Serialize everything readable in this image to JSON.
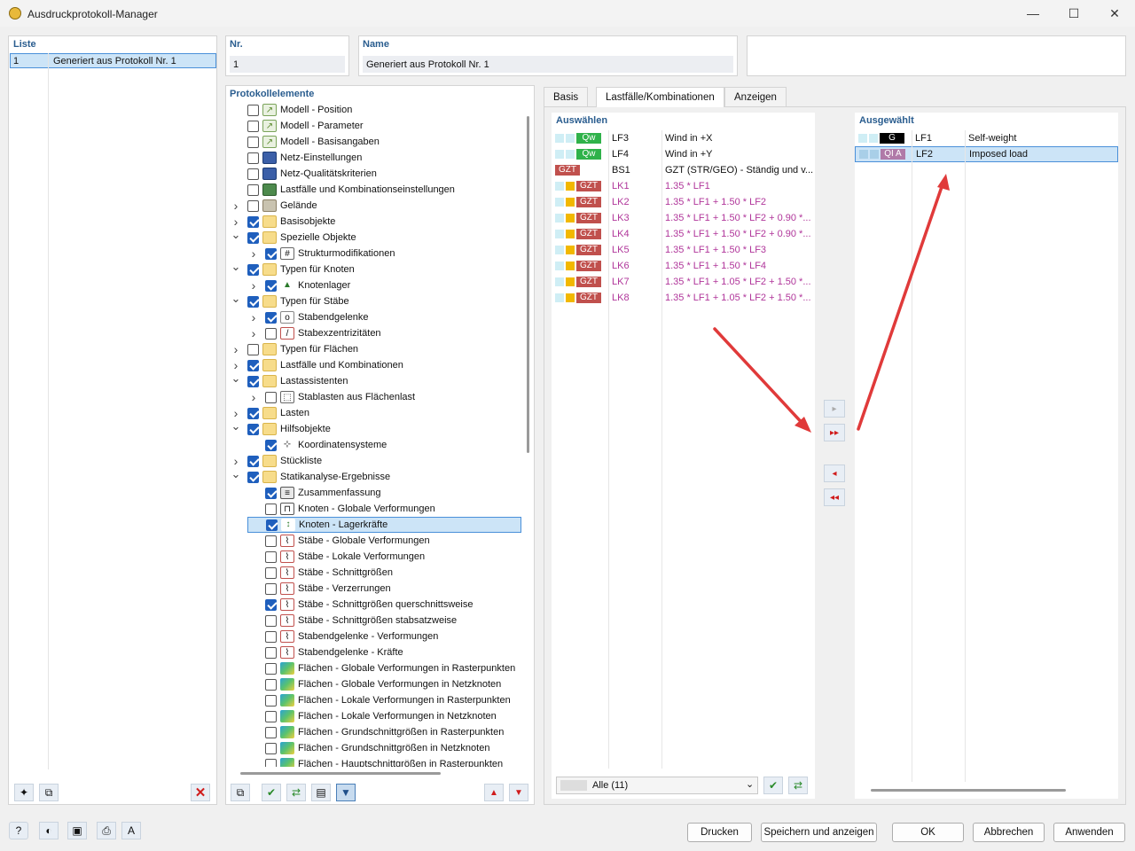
{
  "window": {
    "title": "Ausdruckprotokoll-Manager",
    "min": "—",
    "max": "☐",
    "close": "✕"
  },
  "liste": {
    "header": "Liste",
    "items": [
      {
        "nr": "1",
        "name": "Generiert aus Protokoll Nr. 1"
      }
    ]
  },
  "nr": {
    "label": "Nr.",
    "value": "1"
  },
  "name": {
    "label": "Name",
    "value": "Generiert aus Protokoll Nr. 1"
  },
  "tree": {
    "header": "Protokollelemente",
    "items": [
      {
        "label": "Modell - Position",
        "checked": false,
        "tog": "",
        "level": 0,
        "icon": "model-icon"
      },
      {
        "label": "Modell - Parameter",
        "checked": false,
        "tog": "",
        "level": 0,
        "icon": "model-icon"
      },
      {
        "label": "Modell - Basisangaben",
        "checked": false,
        "tog": "",
        "level": 0,
        "icon": "model-icon"
      },
      {
        "label": "Netz-Einstellungen",
        "checked": false,
        "tog": "",
        "level": 0,
        "icon": "mesh-icon"
      },
      {
        "label": "Netz-Qualitätskriterien",
        "checked": false,
        "tog": "",
        "level": 0,
        "icon": "mesh-icon"
      },
      {
        "label": "Lastfälle und Kombinationseinstellungen",
        "checked": false,
        "tog": "",
        "level": 0,
        "icon": "loadcase-settings-icon"
      },
      {
        "label": "Gelände",
        "checked": false,
        "tog": ">",
        "level": 0,
        "icon": "terrain-icon"
      },
      {
        "label": "Basisobjekte",
        "checked": true,
        "tog": ">",
        "level": 0,
        "icon": "folder-icon"
      },
      {
        "label": "Spezielle Objekte",
        "checked": true,
        "tog": "v",
        "level": 0,
        "icon": "folder-icon"
      },
      {
        "label": "Strukturmodifikationen",
        "checked": true,
        "tog": ">",
        "level": 1,
        "icon": "grid-icon"
      },
      {
        "label": "Typen für Knoten",
        "checked": true,
        "tog": "v",
        "level": 0,
        "icon": "folder-icon"
      },
      {
        "label": "Knotenlager",
        "checked": true,
        "tog": ">",
        "level": 1,
        "icon": "support-icon"
      },
      {
        "label": "Typen für Stäbe",
        "checked": true,
        "tog": "v",
        "level": 0,
        "icon": "folder-icon"
      },
      {
        "label": "Stabendgelenke",
        "checked": true,
        "tog": ">",
        "level": 1,
        "icon": "hinge-icon"
      },
      {
        "label": "Stabexzentrizitäten",
        "checked": false,
        "tog": ">",
        "level": 1,
        "icon": "eccentricity-icon"
      },
      {
        "label": "Typen für Flächen",
        "checked": false,
        "tog": ">",
        "level": 0,
        "icon": "folder-icon"
      },
      {
        "label": "Lastfälle und Kombinationen",
        "checked": true,
        "tog": ">",
        "level": 0,
        "icon": "folder-icon"
      },
      {
        "label": "Lastassistenten",
        "checked": true,
        "tog": "v",
        "level": 0,
        "icon": "folder-icon"
      },
      {
        "label": "Stablasten aus Flächenlast",
        "checked": false,
        "tog": ">",
        "level": 1,
        "icon": "load-wizard-icon"
      },
      {
        "label": "Lasten",
        "checked": true,
        "tog": ">",
        "level": 0,
        "icon": "folder-icon"
      },
      {
        "label": "Hilfsobjekte",
        "checked": true,
        "tog": "v",
        "level": 0,
        "icon": "folder-icon"
      },
      {
        "label": "Koordinatensysteme",
        "checked": true,
        "tog": "",
        "level": 1,
        "icon": "coordinate-icon"
      },
      {
        "label": "Stückliste",
        "checked": true,
        "tog": ">",
        "level": 0,
        "icon": "folder-icon"
      },
      {
        "label": "Statikanalyse-Ergebnisse",
        "checked": true,
        "tog": "v",
        "level": 0,
        "icon": "folder-icon"
      },
      {
        "label": "Zusammenfassung",
        "checked": true,
        "tog": "",
        "level": 1,
        "icon": "summary-icon"
      },
      {
        "label": "Knoten - Globale Verformungen",
        "checked": false,
        "tog": "",
        "level": 1,
        "icon": "node-deform-icon"
      },
      {
        "label": "Knoten - Lagerkräfte",
        "checked": true,
        "tog": "",
        "level": 1,
        "icon": "support-force-icon",
        "selected": true
      },
      {
        "label": "Stäbe - Globale Verformungen",
        "checked": false,
        "tog": "",
        "level": 1,
        "icon": "member-result-icon"
      },
      {
        "label": "Stäbe - Lokale Verformungen",
        "checked": false,
        "tog": "",
        "level": 1,
        "icon": "member-result-icon"
      },
      {
        "label": "Stäbe - Schnittgrößen",
        "checked": false,
        "tog": "",
        "level": 1,
        "icon": "member-result-icon"
      },
      {
        "label": "Stäbe - Verzerrungen",
        "checked": false,
        "tog": "",
        "level": 1,
        "icon": "member-result-icon"
      },
      {
        "label": "Stäbe - Schnittgrößen querschnittsweise",
        "checked": true,
        "tog": "",
        "level": 1,
        "icon": "member-result-icon"
      },
      {
        "label": "Stäbe - Schnittgrößen stabsatzweise",
        "checked": false,
        "tog": "",
        "level": 1,
        "icon": "member-result-icon"
      },
      {
        "label": "Stabendgelenke - Verformungen",
        "checked": false,
        "tog": "",
        "level": 1,
        "icon": "member-result-icon"
      },
      {
        "label": "Stabendgelenke - Kräfte",
        "checked": false,
        "tog": "",
        "level": 1,
        "icon": "member-result-icon"
      },
      {
        "label": "Flächen - Globale Verformungen in Rasterpunkten",
        "checked": false,
        "tog": "",
        "level": 1,
        "icon": "surface-result-icon"
      },
      {
        "label": "Flächen - Globale Verformungen in Netzknoten",
        "checked": false,
        "tog": "",
        "level": 1,
        "icon": "surface-result-icon"
      },
      {
        "label": "Flächen - Lokale Verformungen in Rasterpunkten",
        "checked": false,
        "tog": "",
        "level": 1,
        "icon": "surface-result-icon"
      },
      {
        "label": "Flächen - Lokale Verformungen in Netzknoten",
        "checked": false,
        "tog": "",
        "level": 1,
        "icon": "surface-result-icon"
      },
      {
        "label": "Flächen - Grundschnittgrößen in Rasterpunkten",
        "checked": false,
        "tog": "",
        "level": 1,
        "icon": "surface-result-icon"
      },
      {
        "label": "Flächen - Grundschnittgrößen in Netzknoten",
        "checked": false,
        "tog": "",
        "level": 1,
        "icon": "surface-result-icon"
      },
      {
        "label": "Flächen - Hauptschnittgrößen in Rasterpunkten",
        "checked": false,
        "tog": "",
        "level": 1,
        "icon": "surface-result-icon"
      }
    ]
  },
  "tabs": [
    "Basis",
    "Lastfälle/Kombinationen",
    "Anzeigen"
  ],
  "auswaehlen": {
    "header": "Auswählen",
    "rows": [
      {
        "sq1": "#cfeef5",
        "sq2": "#cfeef5",
        "tag": "Qw",
        "tagColor": "#2fb24a",
        "id": "LF3",
        "desc": "Wind in +X",
        "magenta": false
      },
      {
        "sq1": "#cfeef5",
        "sq2": "#cfeef5",
        "tag": "Qw",
        "tagColor": "#2fb24a",
        "id": "LF4",
        "desc": "Wind in +Y",
        "magenta": false
      },
      {
        "sq1": "",
        "sq2": "",
        "tag": "GZT",
        "tagColor": "#c0504d",
        "id": "BS1",
        "desc": "GZT (STR/GEO) - Ständig und v...",
        "magenta": false
      },
      {
        "sq1": "#cfeef5",
        "sq2": "#f2b800",
        "tag": "GZT",
        "tagColor": "#c0504d",
        "id": "LK1",
        "desc": "1.35 * LF1",
        "magenta": true
      },
      {
        "sq1": "#cfeef5",
        "sq2": "#f2b800",
        "tag": "GZT",
        "tagColor": "#c0504d",
        "id": "LK2",
        "desc": "1.35 * LF1 + 1.50 * LF2",
        "magenta": true
      },
      {
        "sq1": "#cfeef5",
        "sq2": "#f2b800",
        "tag": "GZT",
        "tagColor": "#c0504d",
        "id": "LK3",
        "desc": "1.35 * LF1 + 1.50 * LF2 + 0.90 *...",
        "magenta": true
      },
      {
        "sq1": "#cfeef5",
        "sq2": "#f2b800",
        "tag": "GZT",
        "tagColor": "#c0504d",
        "id": "LK4",
        "desc": "1.35 * LF1 + 1.50 * LF2 + 0.90 *...",
        "magenta": true
      },
      {
        "sq1": "#cfeef5",
        "sq2": "#f2b800",
        "tag": "GZT",
        "tagColor": "#c0504d",
        "id": "LK5",
        "desc": "1.35 * LF1 + 1.50 * LF3",
        "magenta": true
      },
      {
        "sq1": "#cfeef5",
        "sq2": "#f2b800",
        "tag": "GZT",
        "tagColor": "#c0504d",
        "id": "LK6",
        "desc": "1.35 * LF1 + 1.50 * LF4",
        "magenta": true
      },
      {
        "sq1": "#cfeef5",
        "sq2": "#f2b800",
        "tag": "GZT",
        "tagColor": "#c0504d",
        "id": "LK7",
        "desc": "1.35 * LF1 + 1.05 * LF2 + 1.50 *...",
        "magenta": true
      },
      {
        "sq1": "#cfeef5",
        "sq2": "#f2b800",
        "tag": "GZT",
        "tagColor": "#c0504d",
        "id": "LK8",
        "desc": "1.35 * LF1 + 1.05 * LF2 + 1.50 *...",
        "magenta": true
      }
    ],
    "filter": "Alle (11)"
  },
  "ausgewaehlt": {
    "header": "Ausgewählt",
    "rows": [
      {
        "sq1": "#cfeef5",
        "sq2": "#cfeef5",
        "tag": "G",
        "tagColor": "#000000",
        "id": "LF1",
        "desc": "Self-weight",
        "selected": false
      },
      {
        "sq1": "#a9cfe8",
        "sq2": "#a9cfe8",
        "tag": "QI A",
        "tagColor": "#b07aa8",
        "id": "LF2",
        "desc": "Imposed load",
        "selected": true
      }
    ]
  },
  "move": {
    "add_one": "▸",
    "add_all": "▸▸",
    "remove_one": "◂",
    "remove_all": "◂◂"
  },
  "footer": {
    "print": "Drucken",
    "save_show": "Speichern und anzeigen",
    "ok": "OK",
    "cancel": "Abbrechen",
    "apply": "Anwenden"
  },
  "colors": {
    "accent": "#2a5d8f",
    "selection": "#cce4f7",
    "arrow": "#e03a3a",
    "check": "#1f5fbd"
  }
}
